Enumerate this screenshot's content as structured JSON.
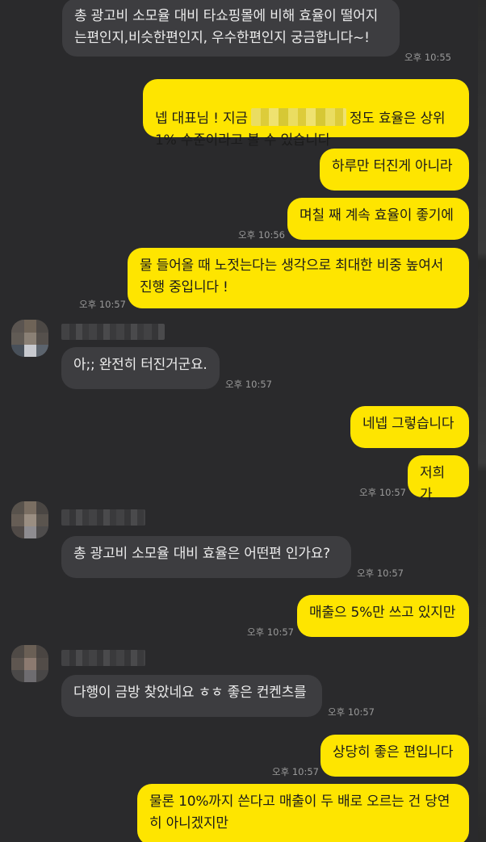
{
  "messages": {
    "m1": {
      "text": "총 광고비 소모율 대비 타쇼핑몰에 비해 효율이 떨어지\n는편인지,비슷한편인지, 우수한편인지 궁금합니다~!",
      "time": "오후 10:55"
    },
    "m2": {
      "before": "넵 대표님 ! 지금",
      "after": "정도 효율은 상위\n1% 수준이라고 볼 수 있습니다"
    },
    "m3": {
      "text": "하루만 터진게 아니라"
    },
    "m4": {
      "text": "며칠 째 계속 효율이 좋기에",
      "time": "오후 10:56"
    },
    "m5": {
      "text": "물 들어올 때 노젓는다는 생각으로 최대한 비중 높여서\n진행 중입니다 !",
      "time": "오후 10:57"
    },
    "m6": {
      "text": "아;; 완전히 터진거군요.",
      "time": "오후 10:57"
    },
    "m7": {
      "text": "네넵 그렇습니다"
    },
    "m8": {
      "text": "저희가",
      "time": "오후 10:57"
    },
    "m9": {
      "text": "총 광고비 소모율 대비 효율은 어떤편 인가요?",
      "time": "오후 10:57"
    },
    "m10": {
      "text": "매출으 5%만 쓰고 있지만",
      "time": "오후 10:57"
    },
    "m11": {
      "text": "다행이 금방 찾았네요 ㅎㅎ 좋은 컨켄츠를",
      "time": "오후 10:57"
    },
    "m12": {
      "text": "상당히 좋은 편입니다",
      "time": "오후 10:57"
    },
    "m13": {
      "text": "물론 10%까지 쓴다고 매출이 두 배로 오르는 건 당연\n히 아니겠지만"
    }
  },
  "colors": {
    "background": "#2a2a2c",
    "incoming_bubble": "#3d3d40",
    "outgoing_bubble": "#fee500"
  },
  "icons": [
    "blurred-avatar-icon",
    "blurred-sender-name"
  ]
}
